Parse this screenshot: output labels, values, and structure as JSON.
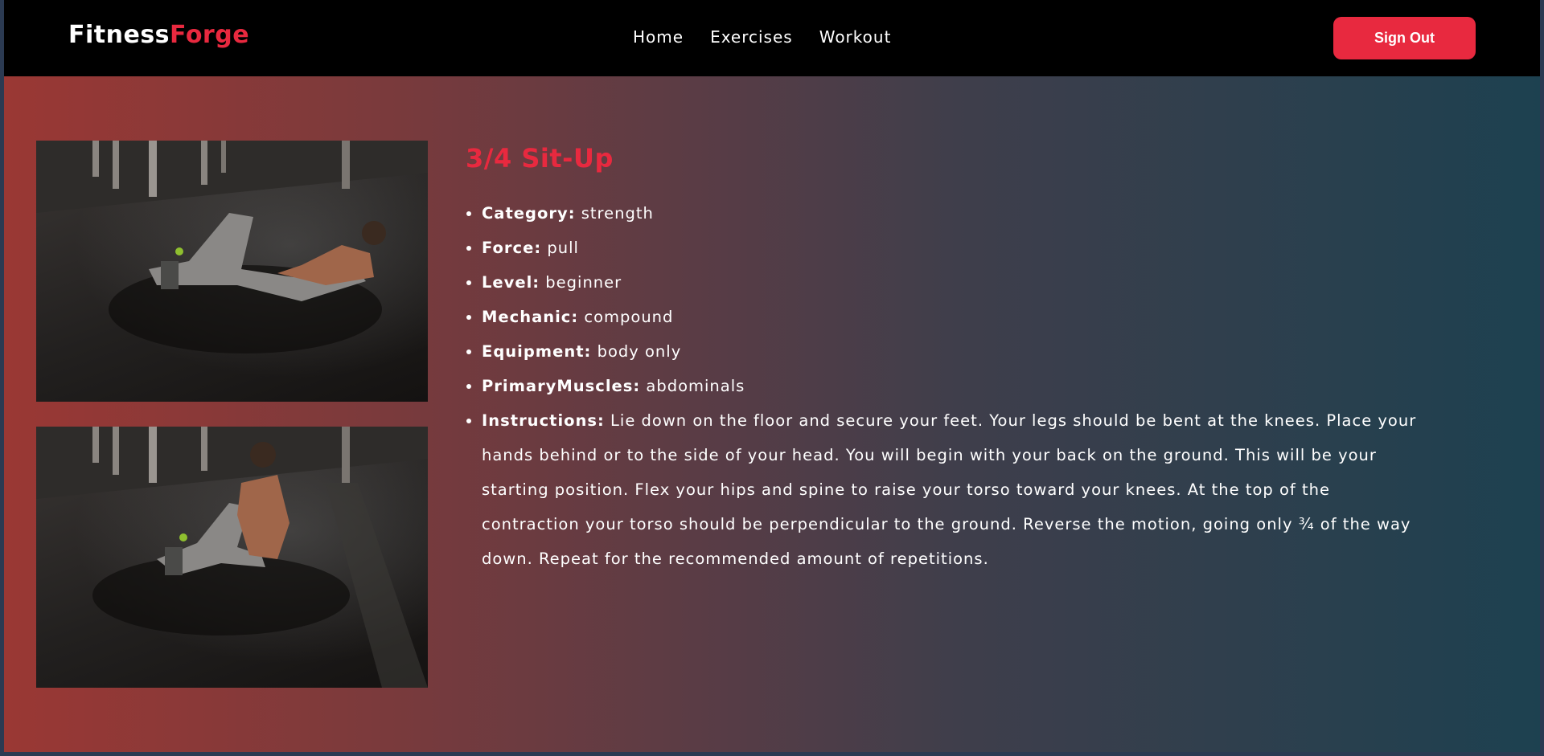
{
  "nav": {
    "logo_primary": "Fitness",
    "logo_accent": "Forge",
    "links": [
      "Home",
      "Exercises",
      "Workout"
    ],
    "signout_label": "Sign Out"
  },
  "exercise": {
    "title": "3/4 Sit-Up",
    "category_label": "Category:",
    "category": "strength",
    "force_label": "Force:",
    "force": "pull",
    "level_label": "Level:",
    "level": "beginner",
    "mechanic_label": "Mechanic:",
    "mechanic": "compound",
    "equipment_label": "Equipment:",
    "equipment": "body only",
    "primary_muscles_label": "PrimaryMuscles:",
    "primary_muscles": "abdominals",
    "instructions_label": "Instructions:",
    "instructions": "Lie down on the floor and secure your feet. Your legs should be bent at the knees. Place your hands behind or to the side of your head. You will begin with your back on the ground. This will be your starting position. Flex your hips and spine to raise your torso toward your knees. At the top of the contraction your torso should be perpendicular to the ground. Reverse the motion, going only ¾ of the way down. Repeat for the recommended amount of repetitions."
  },
  "colors": {
    "accent": "#e8293f",
    "navbar_bg": "#000000",
    "gradient_left": "#9a3834",
    "gradient_right": "#1d4150"
  }
}
